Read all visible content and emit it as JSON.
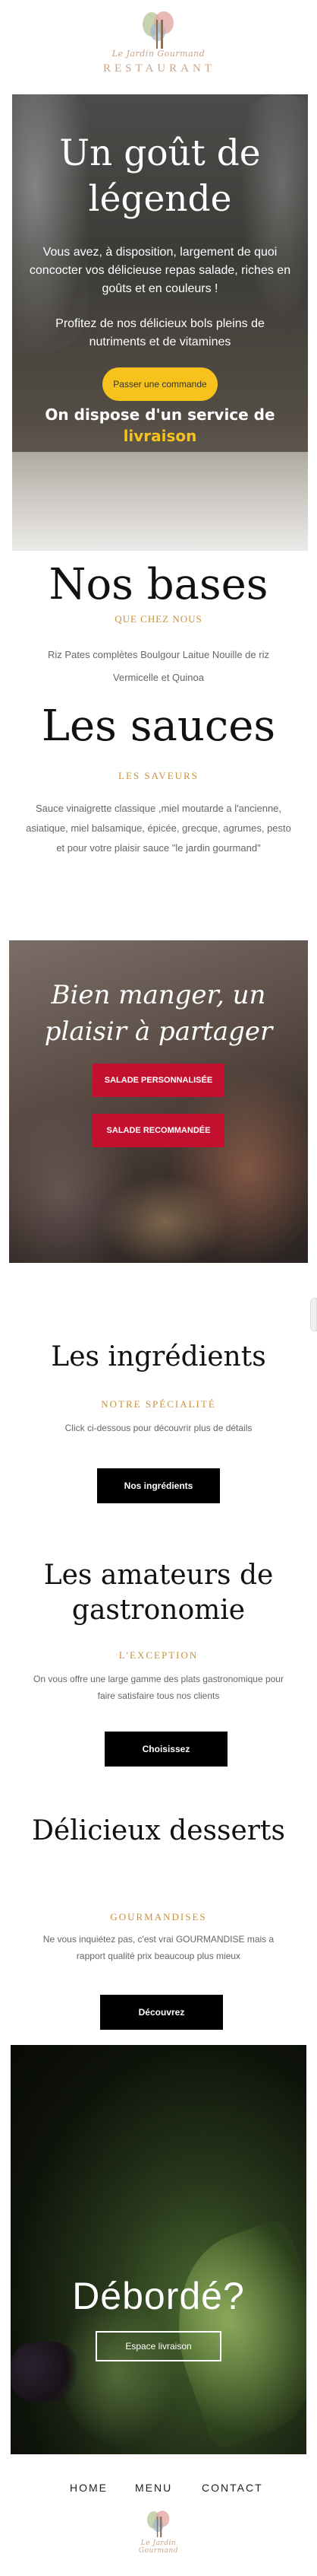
{
  "header": {
    "logo_script": "Le Jardin Gourmand",
    "logo_word": "RESTAURANT",
    "logo_icon": "fork-knife-leaf-icon"
  },
  "hero": {
    "title": "Un goût de légende",
    "paragraph_1": "Vous avez, à disposition, largement de quoi concocter vos délicieuse repas salade, riches en goûts et en couleurs !",
    "paragraph_2": "Profitez de nos délicieux bols pleins de nutriments et de vitamines",
    "button_label": "Passer une commande",
    "delivery_text": "On dispose d'un service de",
    "delivery_highlight": "livraison"
  },
  "bases": {
    "title": "Nos bases",
    "subtitle": "QUE CHEZ NOUS",
    "text": "Riz Pates complètes Boulgour Laitue Nouille de riz Vermicelle et Quinoa"
  },
  "sauces": {
    "title": "Les sauces",
    "subtitle": "LES SAVEURS",
    "text": "Sauce vinaigrette classique ,miel moutarde a l'ancienne, asiatique, miel balsamique, épicée, grecque, agrumes, pesto et pour votre plaisir sauce \"le jardin gourmand\""
  },
  "banner": {
    "title": "Bien manger, un plaisir à partager",
    "button_1": "SALADE PERSONNALISÉE",
    "button_2": "SALADE RECOMMANDÉE"
  },
  "ingredients": {
    "title": "Les ingrédients",
    "subtitle": "NOTRE SPÉCIALITÉ",
    "text": "Click ci-dessous pour découvrir plus de détails",
    "button": "Nos ingrédients"
  },
  "gastronomy": {
    "title": "Les amateurs de gastronomie",
    "subtitle": "L'EXCEPTION",
    "text": "On vous offre une large gamme des plats gastronomique pour faire satisfaire tous nos clients",
    "button": "Choisissez"
  },
  "desserts": {
    "title": "Délicieux desserts",
    "subtitle": "GOURMANDISES",
    "text": "Ne vous inquiétez pas, c'est vrai GOURMANDISE mais a rapport qualité prix beaucoup plus mieux",
    "button": "Découvrez"
  },
  "delivery": {
    "title": "Débordé?",
    "button": "Espace livraison"
  },
  "footer": {
    "nav": [
      "HOME",
      "MENU",
      "CONTACT"
    ],
    "logo_script": "Le Jardin Gourmand"
  },
  "colors": {
    "accent_yellow": "#f6c21b",
    "accent_gold": "#c9923e",
    "accent_red": "#c4102f",
    "logo_rose": "#c8a48a"
  }
}
